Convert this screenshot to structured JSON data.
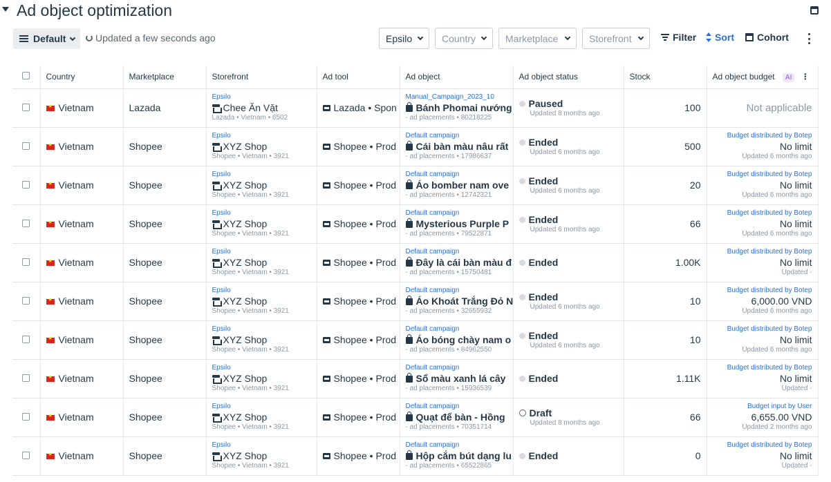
{
  "page": {
    "title": "Ad object optimization"
  },
  "toolbar": {
    "view_label": "Default",
    "updated_text": "Updated a few seconds ago",
    "selects": [
      {
        "label": "Epsilo",
        "filled": true
      },
      {
        "label": "Country",
        "filled": false
      },
      {
        "label": "Marketplace",
        "filled": false
      },
      {
        "label": "Storefront",
        "filled": false
      }
    ],
    "filter_label": "Filter",
    "sort_label": "Sort",
    "cohort_label": "Cohort"
  },
  "table": {
    "columns": [
      "Country",
      "Marketplace",
      "Storefront",
      "Ad tool",
      "Ad object",
      "Ad object status",
      "Stock",
      "Ad object budget"
    ],
    "ai_badge": "AI",
    "rows": [
      {
        "country": "Vietnam",
        "marketplace": "Lazada",
        "store_parent": "Epsilo",
        "store_name": "Chee Ăn Vặt",
        "store_sub": "Lazada • Vietnam • 6502",
        "ad_tool": "Lazada • Spon",
        "campaign": "Manual_Campaign_2023_10",
        "ad_object": "Bánh Phomai nướng",
        "ad_sub": "- ad placements • 80218225",
        "status": "Paused",
        "status_sub": "Updated 8 months ago",
        "status_kind": "dot",
        "stock": "100",
        "budget_label": "",
        "budget_value": "Not applicable",
        "budget_sub": "",
        "budget_na": true
      },
      {
        "country": "Vietnam",
        "marketplace": "Shopee",
        "store_parent": "Epsilo",
        "store_name": "XYZ Shop",
        "store_sub": "Shopee • Vietnam • 3921",
        "ad_tool": "Shopee • Prod",
        "campaign": "Default campaign",
        "ad_object": "Cái bàn màu nâu rất",
        "ad_sub": "- ad placements • 17986637",
        "status": "Ended",
        "status_sub": "Updated 6 months ago",
        "status_kind": "dot",
        "stock": "500",
        "budget_label": "Budget distributed by Botep",
        "budget_value": "No limit",
        "budget_sub": "Updated 6 months ago",
        "budget_na": false
      },
      {
        "country": "Vietnam",
        "marketplace": "Shopee",
        "store_parent": "Epsilo",
        "store_name": "XYZ Shop",
        "store_sub": "Shopee • Vietnam • 3921",
        "ad_tool": "Shopee • Prod",
        "campaign": "Default campaign",
        "ad_object": "Áo bomber nam ove",
        "ad_sub": "- ad placements • 12742321",
        "status": "Ended",
        "status_sub": "Updated 6 months ago",
        "status_kind": "dot",
        "stock": "20",
        "budget_label": "Budget distributed by Botep",
        "budget_value": "No limit",
        "budget_sub": "Updated 6 months ago",
        "budget_na": false
      },
      {
        "country": "Vietnam",
        "marketplace": "Shopee",
        "store_parent": "Epsilo",
        "store_name": "XYZ Shop",
        "store_sub": "Shopee • Vietnam • 3921",
        "ad_tool": "Shopee • Prod",
        "campaign": "Default campaign",
        "ad_object": "Mysterious Purple P",
        "ad_sub": "- ad placements • 79522871",
        "status": "Ended",
        "status_sub": "Updated 6 months ago",
        "status_kind": "dot",
        "stock": "66",
        "budget_label": "Budget distributed by Botep",
        "budget_value": "No limit",
        "budget_sub": "Updated 6 months ago",
        "budget_na": false
      },
      {
        "country": "Vietnam",
        "marketplace": "Shopee",
        "store_parent": "Epsilo",
        "store_name": "XYZ Shop",
        "store_sub": "Shopee • Vietnam • 3921",
        "ad_tool": "Shopee • Prod",
        "campaign": "Default campaign",
        "ad_object": "Đây là cái bàn màu đ",
        "ad_sub": "- ad placements • 15750481",
        "status": "Ended",
        "status_sub": "",
        "status_kind": "dot",
        "stock": "1.00K",
        "budget_label": "Budget distributed by Botep",
        "budget_value": "No limit",
        "budget_sub": "Updated -",
        "budget_na": false
      },
      {
        "country": "Vietnam",
        "marketplace": "Shopee",
        "store_parent": "Epsilo",
        "store_name": "XYZ Shop",
        "store_sub": "Shopee • Vietnam • 3921",
        "ad_tool": "Shopee • Prod",
        "campaign": "Default campaign",
        "ad_object": "Áo Khoát Trắng Đỏ N",
        "ad_sub": "- ad placements • 32655932",
        "status": "Ended",
        "status_sub": "Updated 6 months ago",
        "status_kind": "dot",
        "stock": "10",
        "budget_label": "Budget distributed by Botep",
        "budget_value": "6,000.00 VND",
        "budget_sub": "Updated 6 months ago",
        "budget_na": false
      },
      {
        "country": "Vietnam",
        "marketplace": "Shopee",
        "store_parent": "Epsilo",
        "store_name": "XYZ Shop",
        "store_sub": "Shopee • Vietnam • 3921",
        "ad_tool": "Shopee • Prod",
        "campaign": "Default campaign",
        "ad_object": "Áo bóng chày nam o",
        "ad_sub": "- ad placements • 84962550",
        "status": "Ended",
        "status_sub": "Updated 6 months ago",
        "status_kind": "dot",
        "stock": "10",
        "budget_label": "Budget distributed by Botep",
        "budget_value": "No limit",
        "budget_sub": "Updated 6 months ago",
        "budget_na": false
      },
      {
        "country": "Vietnam",
        "marketplace": "Shopee",
        "store_parent": "Epsilo",
        "store_name": "XYZ Shop",
        "store_sub": "Shopee • Vietnam • 3921",
        "ad_tool": "Shopee • Prod",
        "campaign": "Default campaign",
        "ad_object": "Sổ màu xanh lá cây",
        "ad_sub": "- ad placements • 15936539",
        "status": "Ended",
        "status_sub": "",
        "status_kind": "dot",
        "stock": "1.11K",
        "budget_label": "Budget distributed by Botep",
        "budget_value": "No limit",
        "budget_sub": "Updated -",
        "budget_na": false
      },
      {
        "country": "Vietnam",
        "marketplace": "Shopee",
        "store_parent": "Epsilo",
        "store_name": "XYZ Shop",
        "store_sub": "Shopee • Vietnam • 3921",
        "ad_tool": "Shopee • Prod",
        "campaign": "Default campaign",
        "ad_object": "Quạt để bàn - Hồng",
        "ad_sub": "- ad placements • 70351714",
        "status": "Draft",
        "status_sub": "Updated 8 months ago",
        "status_kind": "draft",
        "stock": "66",
        "budget_label": "Budget input by User",
        "budget_value": "6,655.00 VND",
        "budget_sub": "Updated 2 months ago",
        "budget_na": false
      },
      {
        "country": "Vietnam",
        "marketplace": "Shopee",
        "store_parent": "Epsilo",
        "store_name": "XYZ Shop",
        "store_sub": "Shopee • Vietnam • 3921",
        "ad_tool": "Shopee • Prod",
        "campaign": "Default campaign",
        "ad_object": "Hộp cắm bút dạng lu",
        "ad_sub": "- ad placements • 65522865",
        "status": "Ended",
        "status_sub": "",
        "status_kind": "dot",
        "stock": "0",
        "budget_label": "Budget distributed by Botep",
        "budget_value": "No limit",
        "budget_sub": "Updated -",
        "budget_na": false
      }
    ]
  }
}
